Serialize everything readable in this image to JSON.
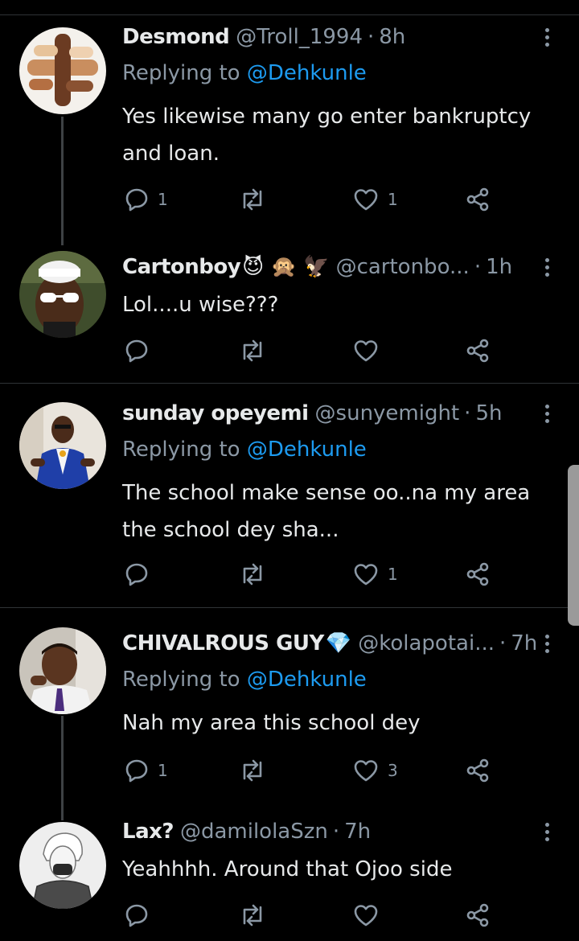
{
  "tweets": [
    {
      "name": "Desmond",
      "emojis": "",
      "handle": "@Troll_1994",
      "time": "8h",
      "replying_prefix": "Replying to",
      "replying_to": "@Dehkunle",
      "text": "Yes likewise many go enter bankruptcy and loan.",
      "replies": "1",
      "retweets": "",
      "likes": "1"
    },
    {
      "name": "Cartonboy",
      "emojis": "😈 🙊 🦅",
      "handle": "@cartonbo...",
      "time": "1h",
      "replying_prefix": "",
      "replying_to": "",
      "text": "Lol....u wise???",
      "replies": "",
      "retweets": "",
      "likes": ""
    },
    {
      "name": "sunday opeyemi",
      "emojis": "",
      "handle": "@sunyemight",
      "time": "5h",
      "replying_prefix": "Replying to",
      "replying_to": "@Dehkunle",
      "text": "The school make sense oo..na my area the school dey sha...",
      "replies": "",
      "retweets": "",
      "likes": "1"
    },
    {
      "name": "CHIVALROUS GUY",
      "emojis": "💎",
      "handle": "@kolapotai...",
      "time": "7h",
      "replying_prefix": "Replying to",
      "replying_to": "@Dehkunle",
      "text": "Nah my area this school dey",
      "replies": "1",
      "retweets": "",
      "likes": "3"
    },
    {
      "name": "Lax?",
      "emojis": "",
      "handle": "@damilolaSzn",
      "time": "7h",
      "replying_prefix": "",
      "replying_to": "",
      "text": "Yeahhhh. Around that Ojoo side",
      "replies": "",
      "retweets": "",
      "likes": ""
    }
  ],
  "icons": {
    "reply": "reply-icon",
    "retweet": "retweet-icon",
    "like": "like-icon",
    "share": "share-icon",
    "more": "more-options-icon"
  },
  "colors": {
    "background": "#000000",
    "text": "#e7e9ea",
    "secondary": "#8b98a5",
    "mention": "#1d9bf0",
    "divider": "#2f3336"
  }
}
